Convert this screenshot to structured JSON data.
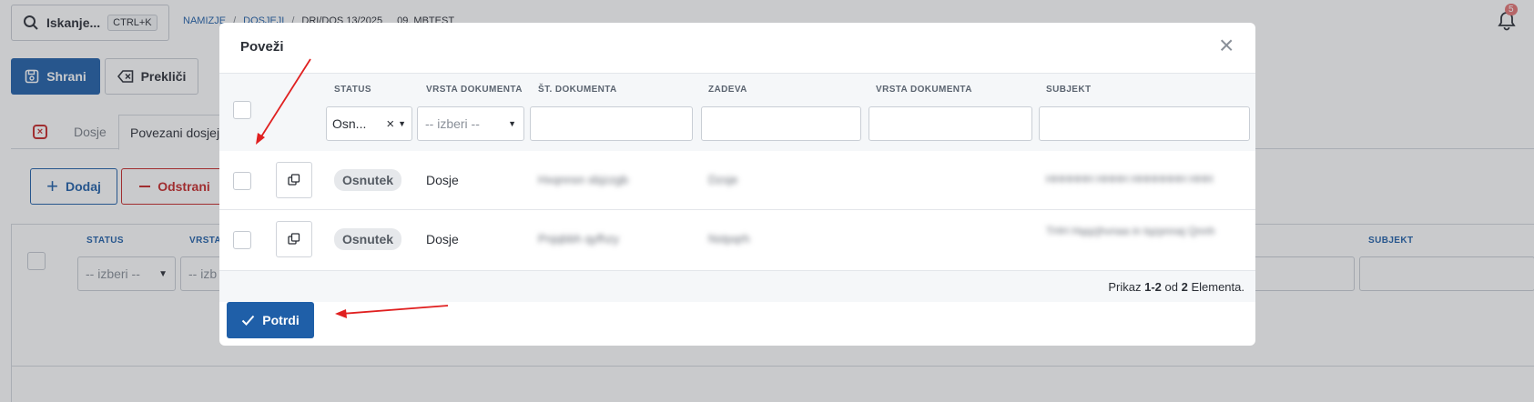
{
  "topbar": {
    "search_label": "Iskanje...",
    "shortcut": "CTRL+K",
    "breadcrumb": [
      "NAMIZJE",
      "DOSJEJI",
      "DRI/DOS 13/2025",
      "09. MBTEST"
    ],
    "notification_count": "5"
  },
  "toolbar": {
    "save_label": "Shrani",
    "cancel_label": "Prekliči"
  },
  "tabs": {
    "dosje": "Dosje",
    "povezani": "Povezani dosjeji"
  },
  "actions": {
    "add_label": "Dodaj",
    "remove_label": "Odstrani"
  },
  "bg_table": {
    "headers": {
      "status": "STATUS",
      "vrsta": "VRSTA",
      "subjekt": "SUBJEKT"
    },
    "filter_placeholder": "-- izberi --",
    "filter_placeholder_partial": "-- izb"
  },
  "modal": {
    "title": "Poveži",
    "headers": [
      "STATUS",
      "VRSTA DOKUMENTA",
      "ŠT. DOKUMENTA",
      "ZADEVA",
      "VRSTA DOKUMENTA",
      "SUBJEKT"
    ],
    "filters": {
      "status_value": "Osn...",
      "vrsta_placeholder": "-- izberi --"
    },
    "rows": [
      {
        "status": "Osnutek",
        "vrsta": "Dosje",
        "st_dokumenta": "Hxqnnsn sbjzzgb",
        "zadeva": "Dzsje",
        "subjekt": "HHHHHH HHHH HHHHHHH HHH"
      },
      {
        "status": "Osnutek",
        "vrsta": "Dosje",
        "st_dokumenta": "Pnjqbbh qyfhzy",
        "zadeva": "Nstpqrh",
        "subjekt": "THH Hqqzjhvnaa in tqzpnnaj Qnnh"
      }
    ],
    "footer": {
      "prefix": "Prikaz ",
      "range": "1-2",
      "mid": " od ",
      "total": "2",
      "suffix": " Elementa."
    },
    "confirm_label": "Potrdi"
  }
}
